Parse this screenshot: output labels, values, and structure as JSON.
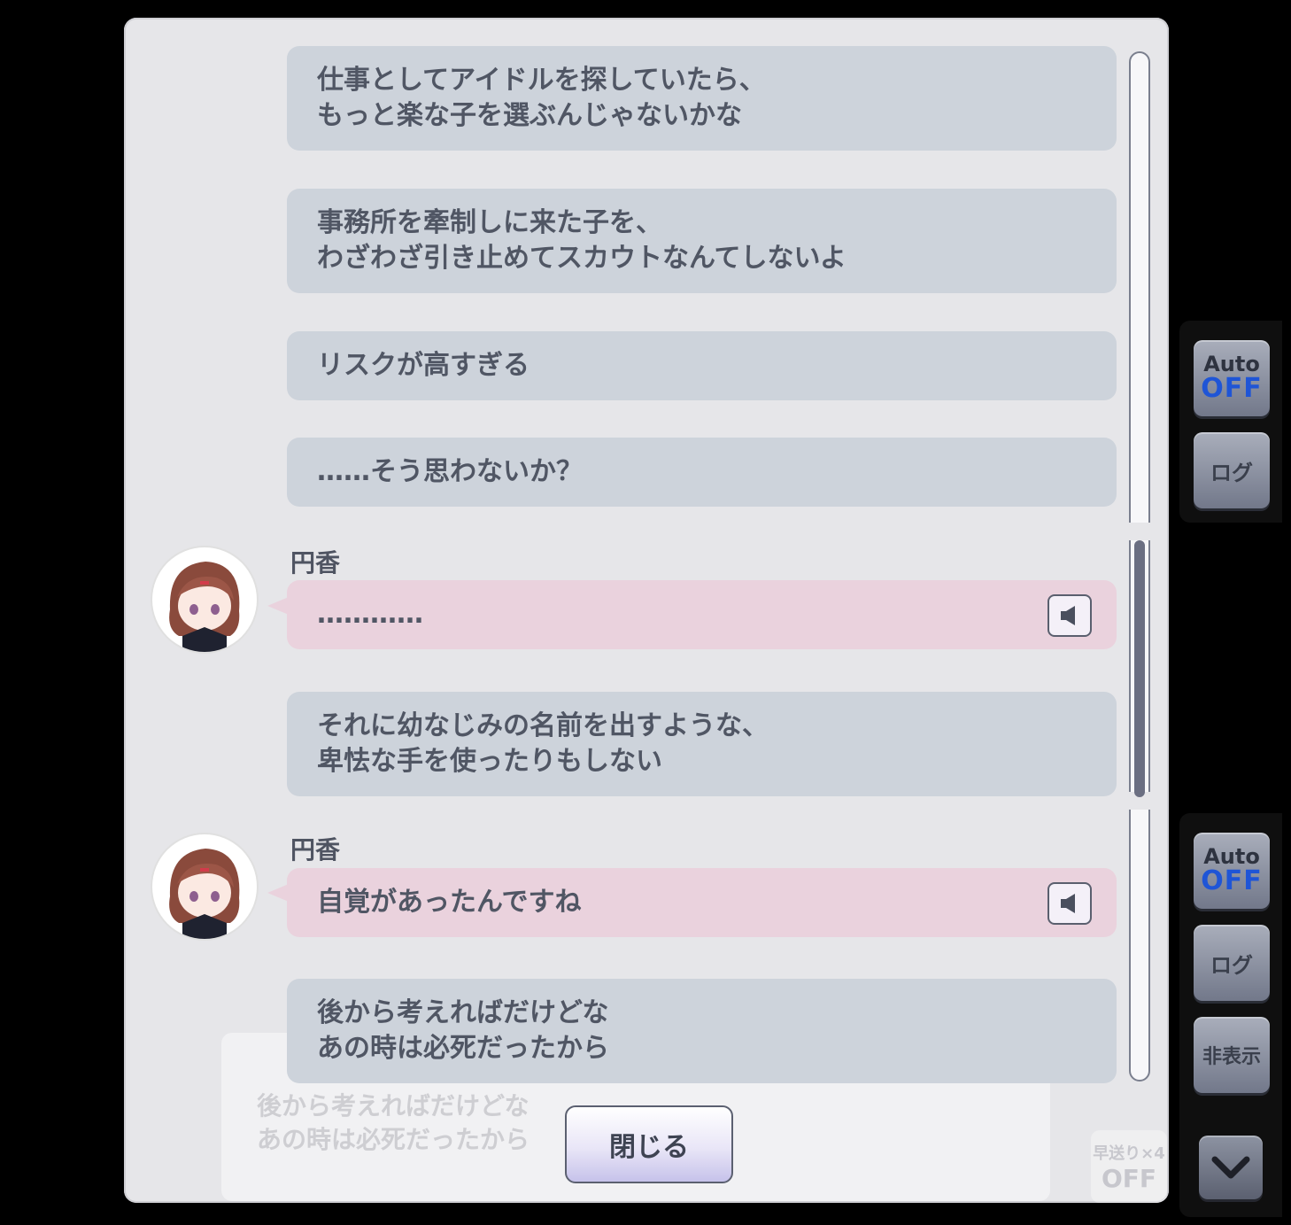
{
  "messages": [
    {
      "text": "仕事としてアイドルを探していたら、\nもっと楽な子を選ぶんじゃないかな"
    },
    {
      "text": "事務所を牽制しに来た子を、\nわざわざ引き止めてスカウトなんてしないよ"
    },
    {
      "text": "リスクが高すぎる"
    },
    {
      "text": "……そう思わないか？"
    },
    {
      "speaker": "円香",
      "text": "…………"
    },
    {
      "text": "それに幼なじみの名前を出すような、\n卑怯な手を使ったりもしない"
    },
    {
      "speaker": "円香",
      "text": "自覚があったんですね"
    },
    {
      "text": "後から考えればだけどな\nあの時は必死だったから"
    }
  ],
  "close_button": {
    "label": "閉じる"
  },
  "background_window": {
    "text": "後から考えればだけどな\nあの時は必死だったから",
    "skip_label": "早送り×4",
    "skip_state": "OFF"
  },
  "side_controls_top": {
    "auto_label": "Auto",
    "auto_state": "OFF",
    "log_label": "ログ"
  },
  "side_controls_bottom": {
    "auto_label": "Auto",
    "auto_state": "OFF",
    "log_label": "ログ",
    "hide_label": "非表示"
  },
  "colors": {
    "protagonist_bubble": "#cdd3db",
    "idol_bubble": "#ead2dd",
    "auto_off": "#1f55d6"
  }
}
